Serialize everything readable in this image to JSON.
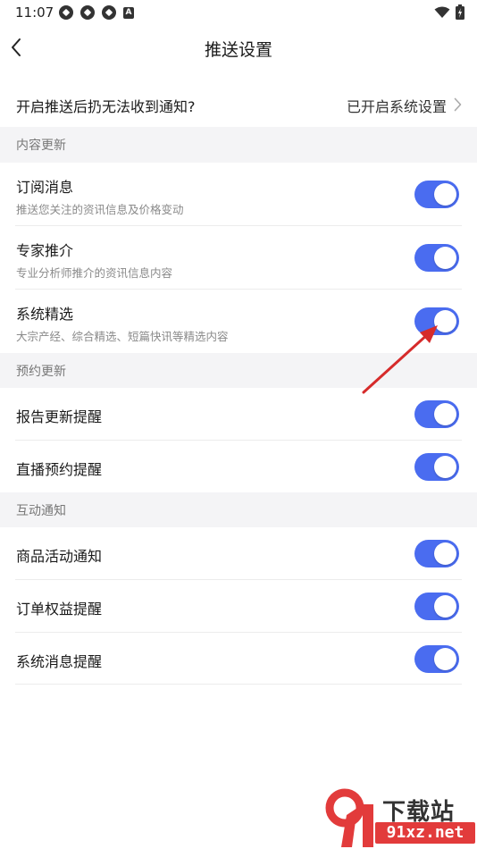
{
  "status_bar": {
    "time": "11:07"
  },
  "header": {
    "title": "推送设置"
  },
  "top_row": {
    "label": "开启推送后扔无法收到通知?",
    "value": "已开启系统设置"
  },
  "sections": [
    {
      "title": "内容更新",
      "items": [
        {
          "title": "订阅消息",
          "desc": "推送您关注的资讯信息及价格变动",
          "enabled": true
        },
        {
          "title": "专家推介",
          "desc": "专业分析师推介的资讯信息内容",
          "enabled": true
        },
        {
          "title": "系统精选",
          "desc": "大宗产经、综合精选、短篇快讯等精选内容",
          "enabled": true
        }
      ]
    },
    {
      "title": "预约更新",
      "items": [
        {
          "title": "报告更新提醒",
          "enabled": true
        },
        {
          "title": "直播预约提醒",
          "enabled": true
        }
      ]
    },
    {
      "title": "互动通知",
      "items": [
        {
          "title": "商品活动通知",
          "enabled": true
        },
        {
          "title": "订单权益提醒",
          "enabled": true
        },
        {
          "title": "系统消息提醒",
          "enabled": true
        }
      ]
    }
  ],
  "watermark": {
    "name": "下载站",
    "url": "91xz.net"
  },
  "colors": {
    "accent": "#4a6cf0",
    "section_bg": "#f4f4f6",
    "annotation": "#d62b2b"
  }
}
